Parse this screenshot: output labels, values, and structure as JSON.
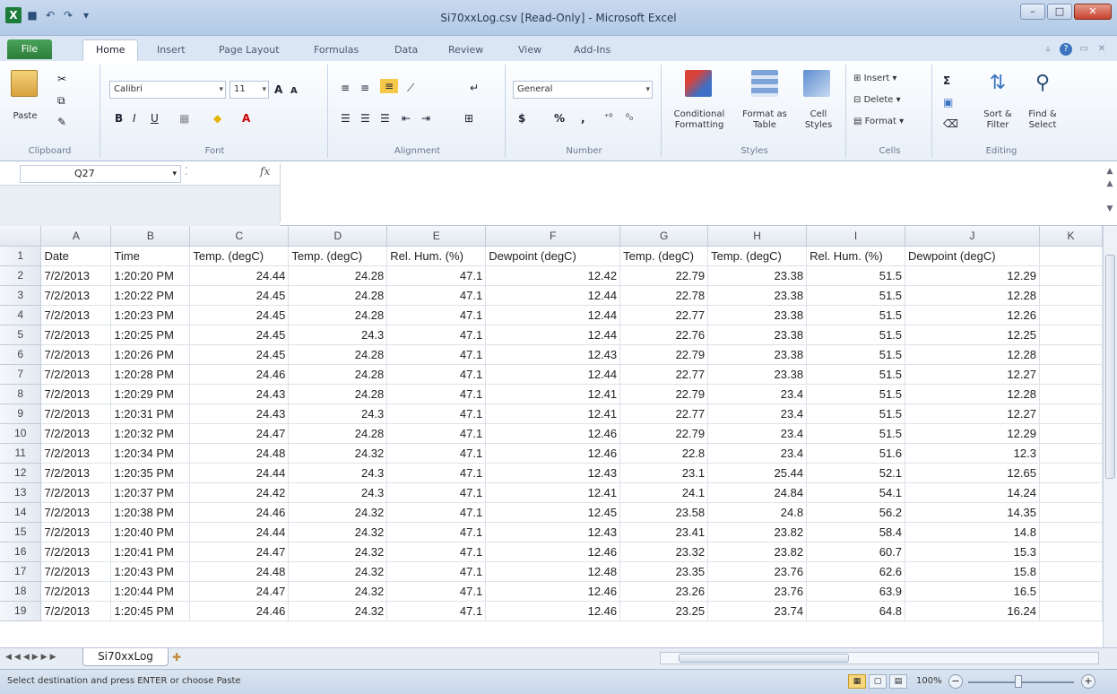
{
  "window": {
    "title": "Si70xxLog.csv [Read-Only] - Microsoft Excel"
  },
  "tabs": [
    {
      "label": "File"
    },
    {
      "label": "Home"
    },
    {
      "label": "Insert"
    },
    {
      "label": "Page Layout"
    },
    {
      "label": "Formulas"
    },
    {
      "label": "Data"
    },
    {
      "label": "Review"
    },
    {
      "label": "View"
    },
    {
      "label": "Add-Ins"
    }
  ],
  "ribbon": {
    "clipboard": {
      "paste": "Paste",
      "label": "Clipboard"
    },
    "font": {
      "name": "Calibri",
      "size": "11",
      "bold": "B",
      "italic": "I",
      "underline": "U",
      "grow": "A",
      "shrink": "A",
      "label": "Font"
    },
    "alignment": {
      "label": "Alignment"
    },
    "number": {
      "format": "General",
      "currency": "$",
      "percent": "%",
      "comma": ",",
      "label": "Number"
    },
    "styles": {
      "conditional": "Conditional Formatting",
      "format_table": "Format as Table",
      "cell_styles": "Cell Styles",
      "label": "Styles"
    },
    "cells": {
      "insert": "Insert",
      "delete": "Delete",
      "format": "Format",
      "label": "Cells"
    },
    "editing": {
      "sum": "Σ",
      "sort": "Sort & Filter",
      "find": "Find & Select",
      "label": "Editing"
    }
  },
  "formula_bar": {
    "name_box": "Q27",
    "fx": "fx",
    "value": ""
  },
  "sheet": {
    "columns": [
      "A",
      "B",
      "C",
      "D",
      "E",
      "F",
      "G",
      "H",
      "I",
      "J",
      "K"
    ],
    "rows": [
      {
        "n": "1",
        "c": [
          "Date",
          "Time",
          "Temp. (degC)",
          "Temp. (degC)",
          "Rel. Hum. (%)",
          "Dewpoint (degC)",
          "Temp. (degC)",
          "Temp. (degC)",
          "Rel. Hum. (%)",
          "Dewpoint (degC)",
          ""
        ]
      },
      {
        "n": "2",
        "c": [
          "7/2/2013",
          "1:20:20 PM",
          "24.44",
          "24.28",
          "47.1",
          "12.42",
          "22.79",
          "23.38",
          "51.5",
          "12.29",
          ""
        ]
      },
      {
        "n": "3",
        "c": [
          "7/2/2013",
          "1:20:22 PM",
          "24.45",
          "24.28",
          "47.1",
          "12.44",
          "22.78",
          "23.38",
          "51.5",
          "12.28",
          ""
        ]
      },
      {
        "n": "4",
        "c": [
          "7/2/2013",
          "1:20:23 PM",
          "24.45",
          "24.28",
          "47.1",
          "12.44",
          "22.77",
          "23.38",
          "51.5",
          "12.26",
          ""
        ]
      },
      {
        "n": "5",
        "c": [
          "7/2/2013",
          "1:20:25 PM",
          "24.45",
          "24.3",
          "47.1",
          "12.44",
          "22.76",
          "23.38",
          "51.5",
          "12.25",
          ""
        ]
      },
      {
        "n": "6",
        "c": [
          "7/2/2013",
          "1:20:26 PM",
          "24.45",
          "24.28",
          "47.1",
          "12.43",
          "22.79",
          "23.38",
          "51.5",
          "12.28",
          ""
        ]
      },
      {
        "n": "7",
        "c": [
          "7/2/2013",
          "1:20:28 PM",
          "24.46",
          "24.28",
          "47.1",
          "12.44",
          "22.77",
          "23.38",
          "51.5",
          "12.27",
          ""
        ]
      },
      {
        "n": "8",
        "c": [
          "7/2/2013",
          "1:20:29 PM",
          "24.43",
          "24.28",
          "47.1",
          "12.41",
          "22.79",
          "23.4",
          "51.5",
          "12.28",
          ""
        ]
      },
      {
        "n": "9",
        "c": [
          "7/2/2013",
          "1:20:31 PM",
          "24.43",
          "24.3",
          "47.1",
          "12.41",
          "22.77",
          "23.4",
          "51.5",
          "12.27",
          ""
        ]
      },
      {
        "n": "10",
        "c": [
          "7/2/2013",
          "1:20:32 PM",
          "24.47",
          "24.28",
          "47.1",
          "12.46",
          "22.79",
          "23.4",
          "51.5",
          "12.29",
          ""
        ]
      },
      {
        "n": "11",
        "c": [
          "7/2/2013",
          "1:20:34 PM",
          "24.48",
          "24.32",
          "47.1",
          "12.46",
          "22.8",
          "23.4",
          "51.6",
          "12.3",
          ""
        ]
      },
      {
        "n": "12",
        "c": [
          "7/2/2013",
          "1:20:35 PM",
          "24.44",
          "24.3",
          "47.1",
          "12.43",
          "23.1",
          "25.44",
          "52.1",
          "12.65",
          ""
        ]
      },
      {
        "n": "13",
        "c": [
          "7/2/2013",
          "1:20:37 PM",
          "24.42",
          "24.3",
          "47.1",
          "12.41",
          "24.1",
          "24.84",
          "54.1",
          "14.24",
          ""
        ]
      },
      {
        "n": "14",
        "c": [
          "7/2/2013",
          "1:20:38 PM",
          "24.46",
          "24.32",
          "47.1",
          "12.45",
          "23.58",
          "24.8",
          "56.2",
          "14.35",
          ""
        ]
      },
      {
        "n": "15",
        "c": [
          "7/2/2013",
          "1:20:40 PM",
          "24.44",
          "24.32",
          "47.1",
          "12.43",
          "23.41",
          "23.82",
          "58.4",
          "14.8",
          ""
        ]
      },
      {
        "n": "16",
        "c": [
          "7/2/2013",
          "1:20:41 PM",
          "24.47",
          "24.32",
          "47.1",
          "12.46",
          "23.32",
          "23.82",
          "60.7",
          "15.3",
          ""
        ]
      },
      {
        "n": "17",
        "c": [
          "7/2/2013",
          "1:20:43 PM",
          "24.48",
          "24.32",
          "47.1",
          "12.48",
          "23.35",
          "23.76",
          "62.6",
          "15.8",
          ""
        ]
      },
      {
        "n": "18",
        "c": [
          "7/2/2013",
          "1:20:44 PM",
          "24.47",
          "24.32",
          "47.1",
          "12.46",
          "23.26",
          "23.76",
          "63.9",
          "16.5",
          ""
        ]
      },
      {
        "n": "19",
        "c": [
          "7/2/2013",
          "1:20:45 PM",
          "24.46",
          "24.32",
          "47.1",
          "12.46",
          "23.25",
          "23.74",
          "64.8",
          "16.24",
          ""
        ]
      }
    ],
    "tab_name": "Si70xxLog"
  },
  "status": {
    "message": "Select destination and press ENTER or choose Paste",
    "zoom": "100%"
  },
  "colors": {
    "excel_green": "#1e7c3a",
    "ribbon_blue": "#dbe6f4"
  }
}
